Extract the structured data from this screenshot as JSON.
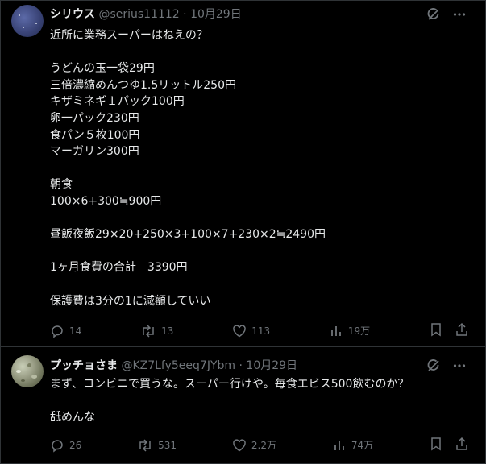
{
  "tweets": [
    {
      "name": "シリウス",
      "handle": "@serius11112",
      "date": "10月29日",
      "body": "近所に業務スーパーはねえの？\n\nうどんの玉一袋29円\n三倍濃縮めんつゆ1.5リットル250円\nキザミネギ１パック100円\n卵一パック230円\n食パン５枚100円\nマーガリン300円\n\n朝食\n100×6+300≒900円\n\n昼飯夜飯29×20+250×3+100×7+230×2≒2490円\n\n1ヶ月食費の合計　3390円\n\n保護費は3分の1に減額していい",
      "replies": "14",
      "retweets": "13",
      "likes": "113",
      "views": "19万"
    },
    {
      "name": "プッチョさま",
      "handle": "@KZ7Lfy5eeq7JYbm",
      "date": "10月29日",
      "body": "まず、コンビニで買うな。スーパー行けや。毎食エビス500飲むのか？\n\n舐めんな",
      "replies": "26",
      "retweets": "531",
      "likes": "2.2万",
      "views": "74万"
    }
  ],
  "separator": " · ",
  "icons": [
    "grok-icon",
    "more-icon",
    "reply-icon",
    "retweet-icon",
    "like-icon",
    "views-icon",
    "bookmark-icon",
    "share-icon"
  ]
}
